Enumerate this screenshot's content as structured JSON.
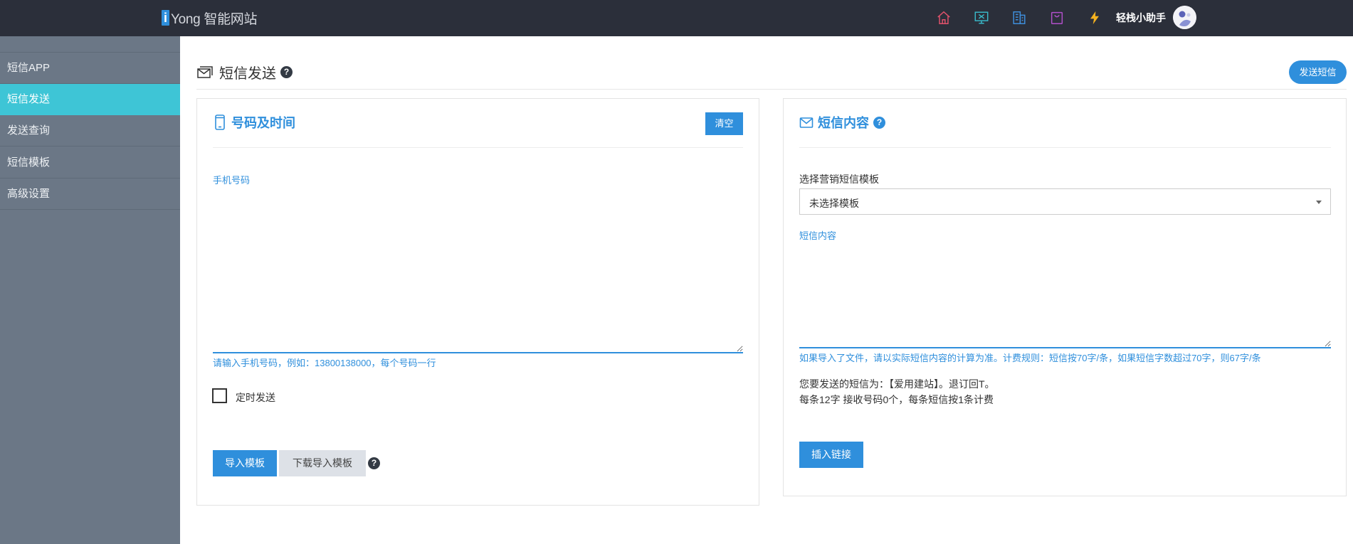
{
  "header": {
    "logo_letter": "i",
    "logo_text": "Yong 智能网站",
    "user_name": "轻栈小助手",
    "icons": [
      "home-icon",
      "monitor-icon",
      "building-icon",
      "shopping-bag-icon",
      "lightning-icon"
    ],
    "colors": {
      "bar": "#2b2f3a",
      "home": "#e0526b",
      "monitor": "#39b8c8",
      "building": "#3f8fdc",
      "bag": "#b04fc9",
      "bolt": "#f5b21f"
    }
  },
  "sidebar": {
    "items": [
      {
        "label": "短信APP"
      },
      {
        "label": "短信发送",
        "active": true
      },
      {
        "label": "发送查询"
      },
      {
        "label": "短信模板"
      },
      {
        "label": "高级设置"
      }
    ]
  },
  "page": {
    "title": "短信发送",
    "title_help": "?",
    "send_button": "发送短信"
  },
  "left_panel": {
    "title": "号码及时间",
    "clear_button": "清空",
    "phone_label": "手机号码",
    "phone_value": "",
    "phone_hint": "请输入手机号码，例如：13800138000，每个号码一行",
    "schedule_label": "定时发送",
    "schedule_checked": false,
    "import_button": "导入模板",
    "download_button": "下载导入模板",
    "help": "?"
  },
  "right_panel": {
    "title": "短信内容",
    "title_help": "?",
    "template_label": "选择营销短信模板",
    "template_selected": "未选择模板",
    "content_label": "短信内容",
    "content_value": "",
    "billing_hint": "如果导入了文件，请以实际短信内容的计算为准。计费规则：短信按70字/条，如果短信字数超过70字，则67字/条",
    "preview_line1": "您要发送的短信为：【爱用建站】。退订回T。",
    "preview_line2": "每条12字 接收号码0个，每条短信按1条计费",
    "insert_link_button": "插入链接"
  }
}
